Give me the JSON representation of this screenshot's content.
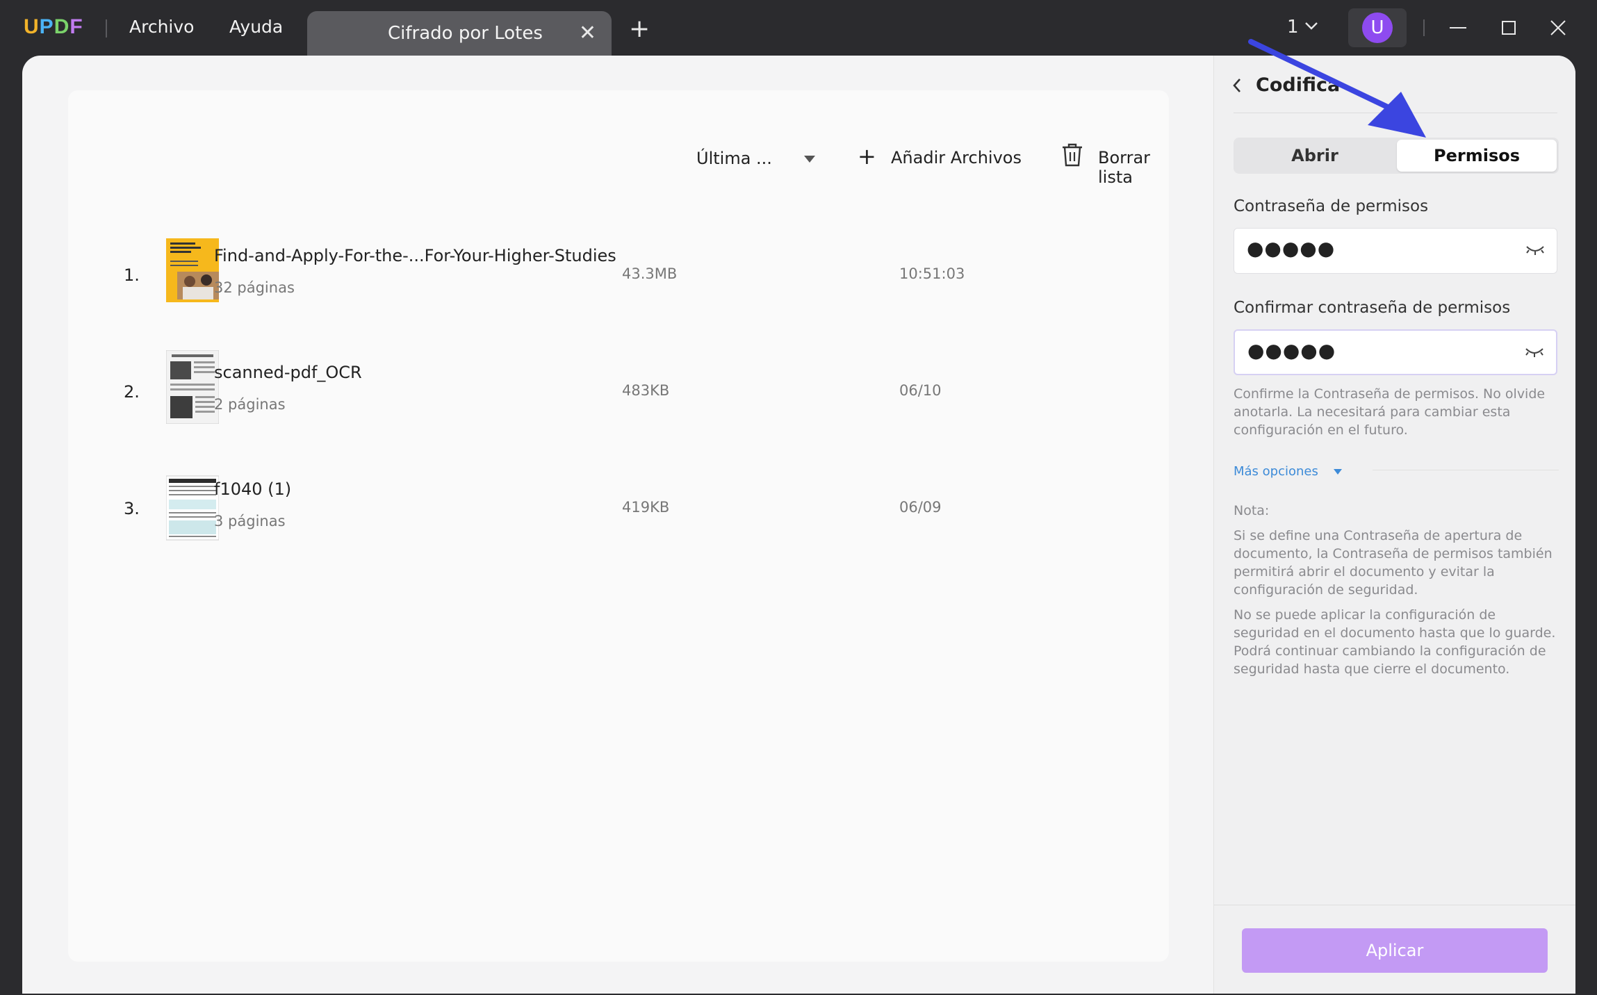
{
  "titlebar": {
    "logo": "UPDF",
    "menu": [
      "Archivo",
      "Ayuda"
    ],
    "tab_label": "Cifrado por Lotes",
    "page_indicator": "1",
    "avatar_letter": "U"
  },
  "toolbar": {
    "sort_label": "Última ...",
    "add_label": "Añadir Archivos",
    "clear_label": "Borrar lista"
  },
  "files": [
    {
      "index": "1.",
      "name": "Find-and-Apply-For-the-...For-Your-Higher-Studies",
      "pages": "32 páginas",
      "size": "43.3MB",
      "date": "10:51:03"
    },
    {
      "index": "2.",
      "name": "scanned-pdf_OCR",
      "pages": "2 páginas",
      "size": "483KB",
      "date": "06/10"
    },
    {
      "index": "3.",
      "name": "f1040 (1)",
      "pages": "3 páginas",
      "size": "419KB",
      "date": "06/09"
    }
  ],
  "panel": {
    "title": "Codifica",
    "tabs": {
      "open": "Abrir",
      "permissions": "Permisos"
    },
    "perm_password_label": "Contraseña de permisos",
    "perm_password_value": "●●●●●",
    "confirm_label": "Confirmar contraseña de permisos",
    "confirm_value": "●●●●●",
    "hint": "Confirme la Contraseña de permisos. No olvide anotarla. La necesitará para cambiar esta configuración en el futuro.",
    "more_options": "Más opciones",
    "note_title": "Nota:",
    "note_1": "Si se define una Contraseña de apertura de documento, la Contraseña de permisos también permitirá abrir el documento  y evitar la configuración de seguridad.",
    "note_2": "No se puede aplicar la configuración de seguridad en el documento hasta que lo guarde. Podrá continuar cambiando la configuración de seguridad hasta que cierre el documento.",
    "apply": "Aplicar"
  },
  "colors": {
    "accent": "#c39af4",
    "avatar": "#8e4bf0",
    "link": "#3d8bd8",
    "annotation_arrow": "#3b45e0"
  }
}
